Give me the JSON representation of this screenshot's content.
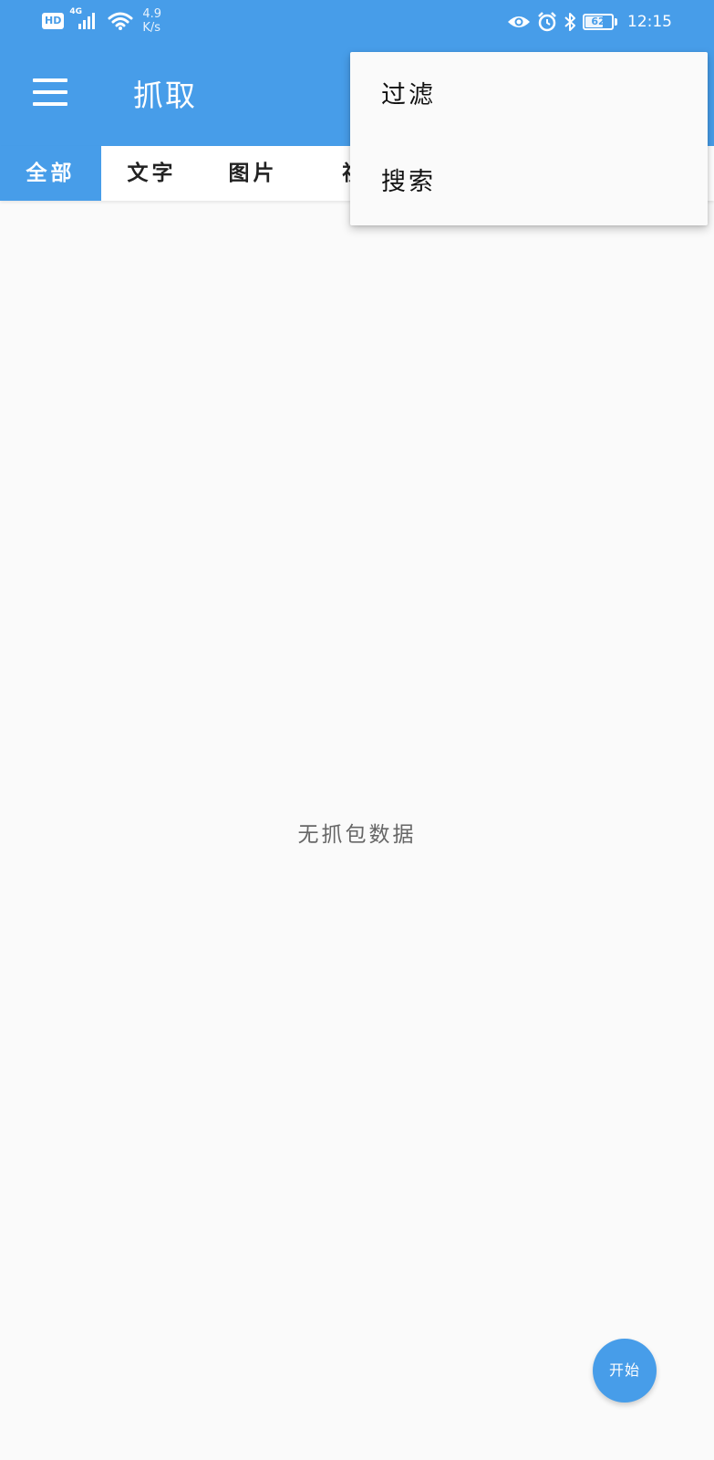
{
  "status_bar": {
    "network_badge": "HD",
    "network_type": "4G",
    "speed_value": "4.9",
    "speed_unit": "K/s",
    "battery_level": "62",
    "time": "12:15"
  },
  "app_bar": {
    "title": "抓取"
  },
  "tabs": [
    {
      "label": "全部",
      "active": true
    },
    {
      "label": "文字",
      "active": false
    },
    {
      "label": "图片",
      "active": false
    },
    {
      "label": "视",
      "active": false
    }
  ],
  "empty_state": {
    "message": "无抓包数据"
  },
  "fab": {
    "label": "开始"
  },
  "overflow_menu": {
    "items": [
      {
        "label": "过滤"
      },
      {
        "label": "搜索"
      }
    ]
  },
  "colors": {
    "primary": "#479de9",
    "background": "#fafafa",
    "text_primary": "#222222",
    "text_secondary": "#666666"
  }
}
